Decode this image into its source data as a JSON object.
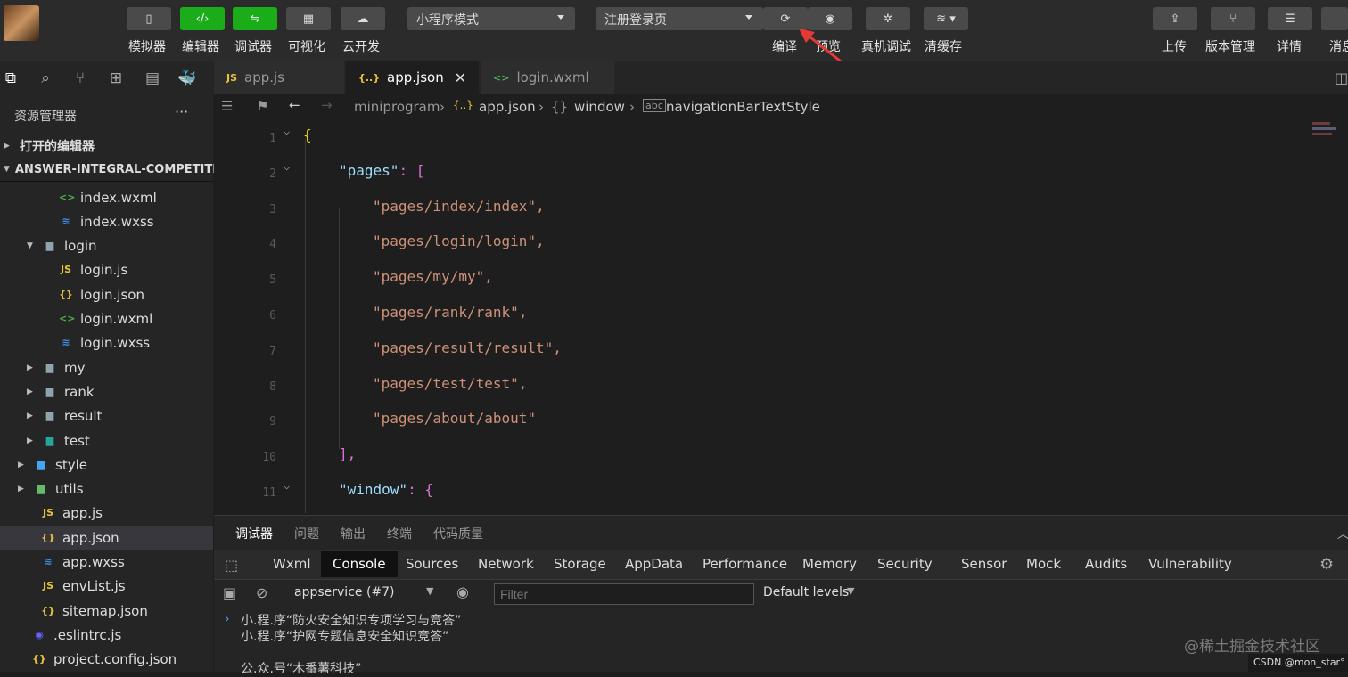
{
  "toolbar": {
    "buttons": [
      {
        "label": "模拟器",
        "icon": "phone-icon"
      },
      {
        "label": "编辑器",
        "icon": "code-icon"
      },
      {
        "label": "调试器",
        "icon": "debugger-icon"
      },
      {
        "label": "可视化",
        "icon": "visual-icon"
      },
      {
        "label": "云开发",
        "icon": "cloud-icon"
      }
    ],
    "mode_select": "小程序模式",
    "compile_select": "注册登录页",
    "compile_label": "编译",
    "preview_label": "预览",
    "device_debug_label": "真机调试",
    "clear_cache_label": "清缓存",
    "upload_label": "上传",
    "version_label": "版本管理",
    "details_label": "详情",
    "messages_label": "消息"
  },
  "tabs": [
    {
      "label": "app.js",
      "icon": "JS"
    },
    {
      "label": "app.json",
      "icon": "{..}"
    },
    {
      "label": "login.wxml",
      "icon": "<>"
    }
  ],
  "sidebar": {
    "title": "资源管理器",
    "more": "···",
    "open_editors": "打开的编辑器",
    "project": "ANSWER-INTEGRAL-COMPETITI...",
    "items": [
      {
        "label": "index.wxml",
        "type": "wxml"
      },
      {
        "label": "index.wxss",
        "type": "wxss"
      },
      {
        "label": "login",
        "type": "folder-open"
      },
      {
        "label": "login.js",
        "type": "js"
      },
      {
        "label": "login.json",
        "type": "json"
      },
      {
        "label": "login.wxml",
        "type": "wxml"
      },
      {
        "label": "login.wxss",
        "type": "wxss"
      },
      {
        "label": "my",
        "type": "folder"
      },
      {
        "label": "rank",
        "type": "folder"
      },
      {
        "label": "result",
        "type": "folder"
      },
      {
        "label": "test",
        "type": "folder-test"
      },
      {
        "label": "style",
        "type": "folder-style"
      },
      {
        "label": "utils",
        "type": "folder-utils"
      },
      {
        "label": "app.js",
        "type": "js"
      },
      {
        "label": "app.json",
        "type": "json"
      },
      {
        "label": "app.wxss",
        "type": "wxss"
      },
      {
        "label": "envList.js",
        "type": "js"
      },
      {
        "label": "sitemap.json",
        "type": "json"
      },
      {
        "label": ".eslintrc.js",
        "type": "eslint"
      },
      {
        "label": "project.config.json",
        "type": "json"
      }
    ]
  },
  "breadcrumb": [
    "miniprogram",
    "app.json",
    "window",
    "navigationBarTextStyle"
  ],
  "editor": {
    "lines": [
      {
        "n": "1",
        "text": "{"
      },
      {
        "n": "2",
        "key": "\"pages\"",
        "rest": ": ["
      },
      {
        "n": "3",
        "str": "\"pages/index/index\","
      },
      {
        "n": "4",
        "str": "\"pages/login/login\","
      },
      {
        "n": "5",
        "str": "\"pages/my/my\","
      },
      {
        "n": "6",
        "str": "\"pages/rank/rank\","
      },
      {
        "n": "7",
        "str": "\"pages/result/result\","
      },
      {
        "n": "8",
        "str": "\"pages/test/test\","
      },
      {
        "n": "9",
        "str": "\"pages/about/about\""
      },
      {
        "n": "10",
        "text": "],"
      },
      {
        "n": "11",
        "key": "\"window\"",
        "rest": ": {"
      }
    ]
  },
  "panel": {
    "tabs": [
      "调试器",
      "问题",
      "输出",
      "终端",
      "代码质量"
    ],
    "devtools_tabs": [
      "Wxml",
      "Console",
      "Sources",
      "Network",
      "Storage",
      "AppData",
      "Performance",
      "Memory",
      "Security",
      "Sensor",
      "Mock",
      "Audits",
      "Vulnerability"
    ],
    "context_select": "appservice (#7)",
    "filter_placeholder": "Filter",
    "levels": "Default levels",
    "console_lines": [
      "小.程.序“防火安全知识专项学习与竞答”",
      "小.程.序“护网专题信息安全知识竞答”",
      "公.众.号“木番薯科技”"
    ]
  },
  "watermark": "@稀土掘金技术社区",
  "csdn": "CSDN @mon_star°"
}
